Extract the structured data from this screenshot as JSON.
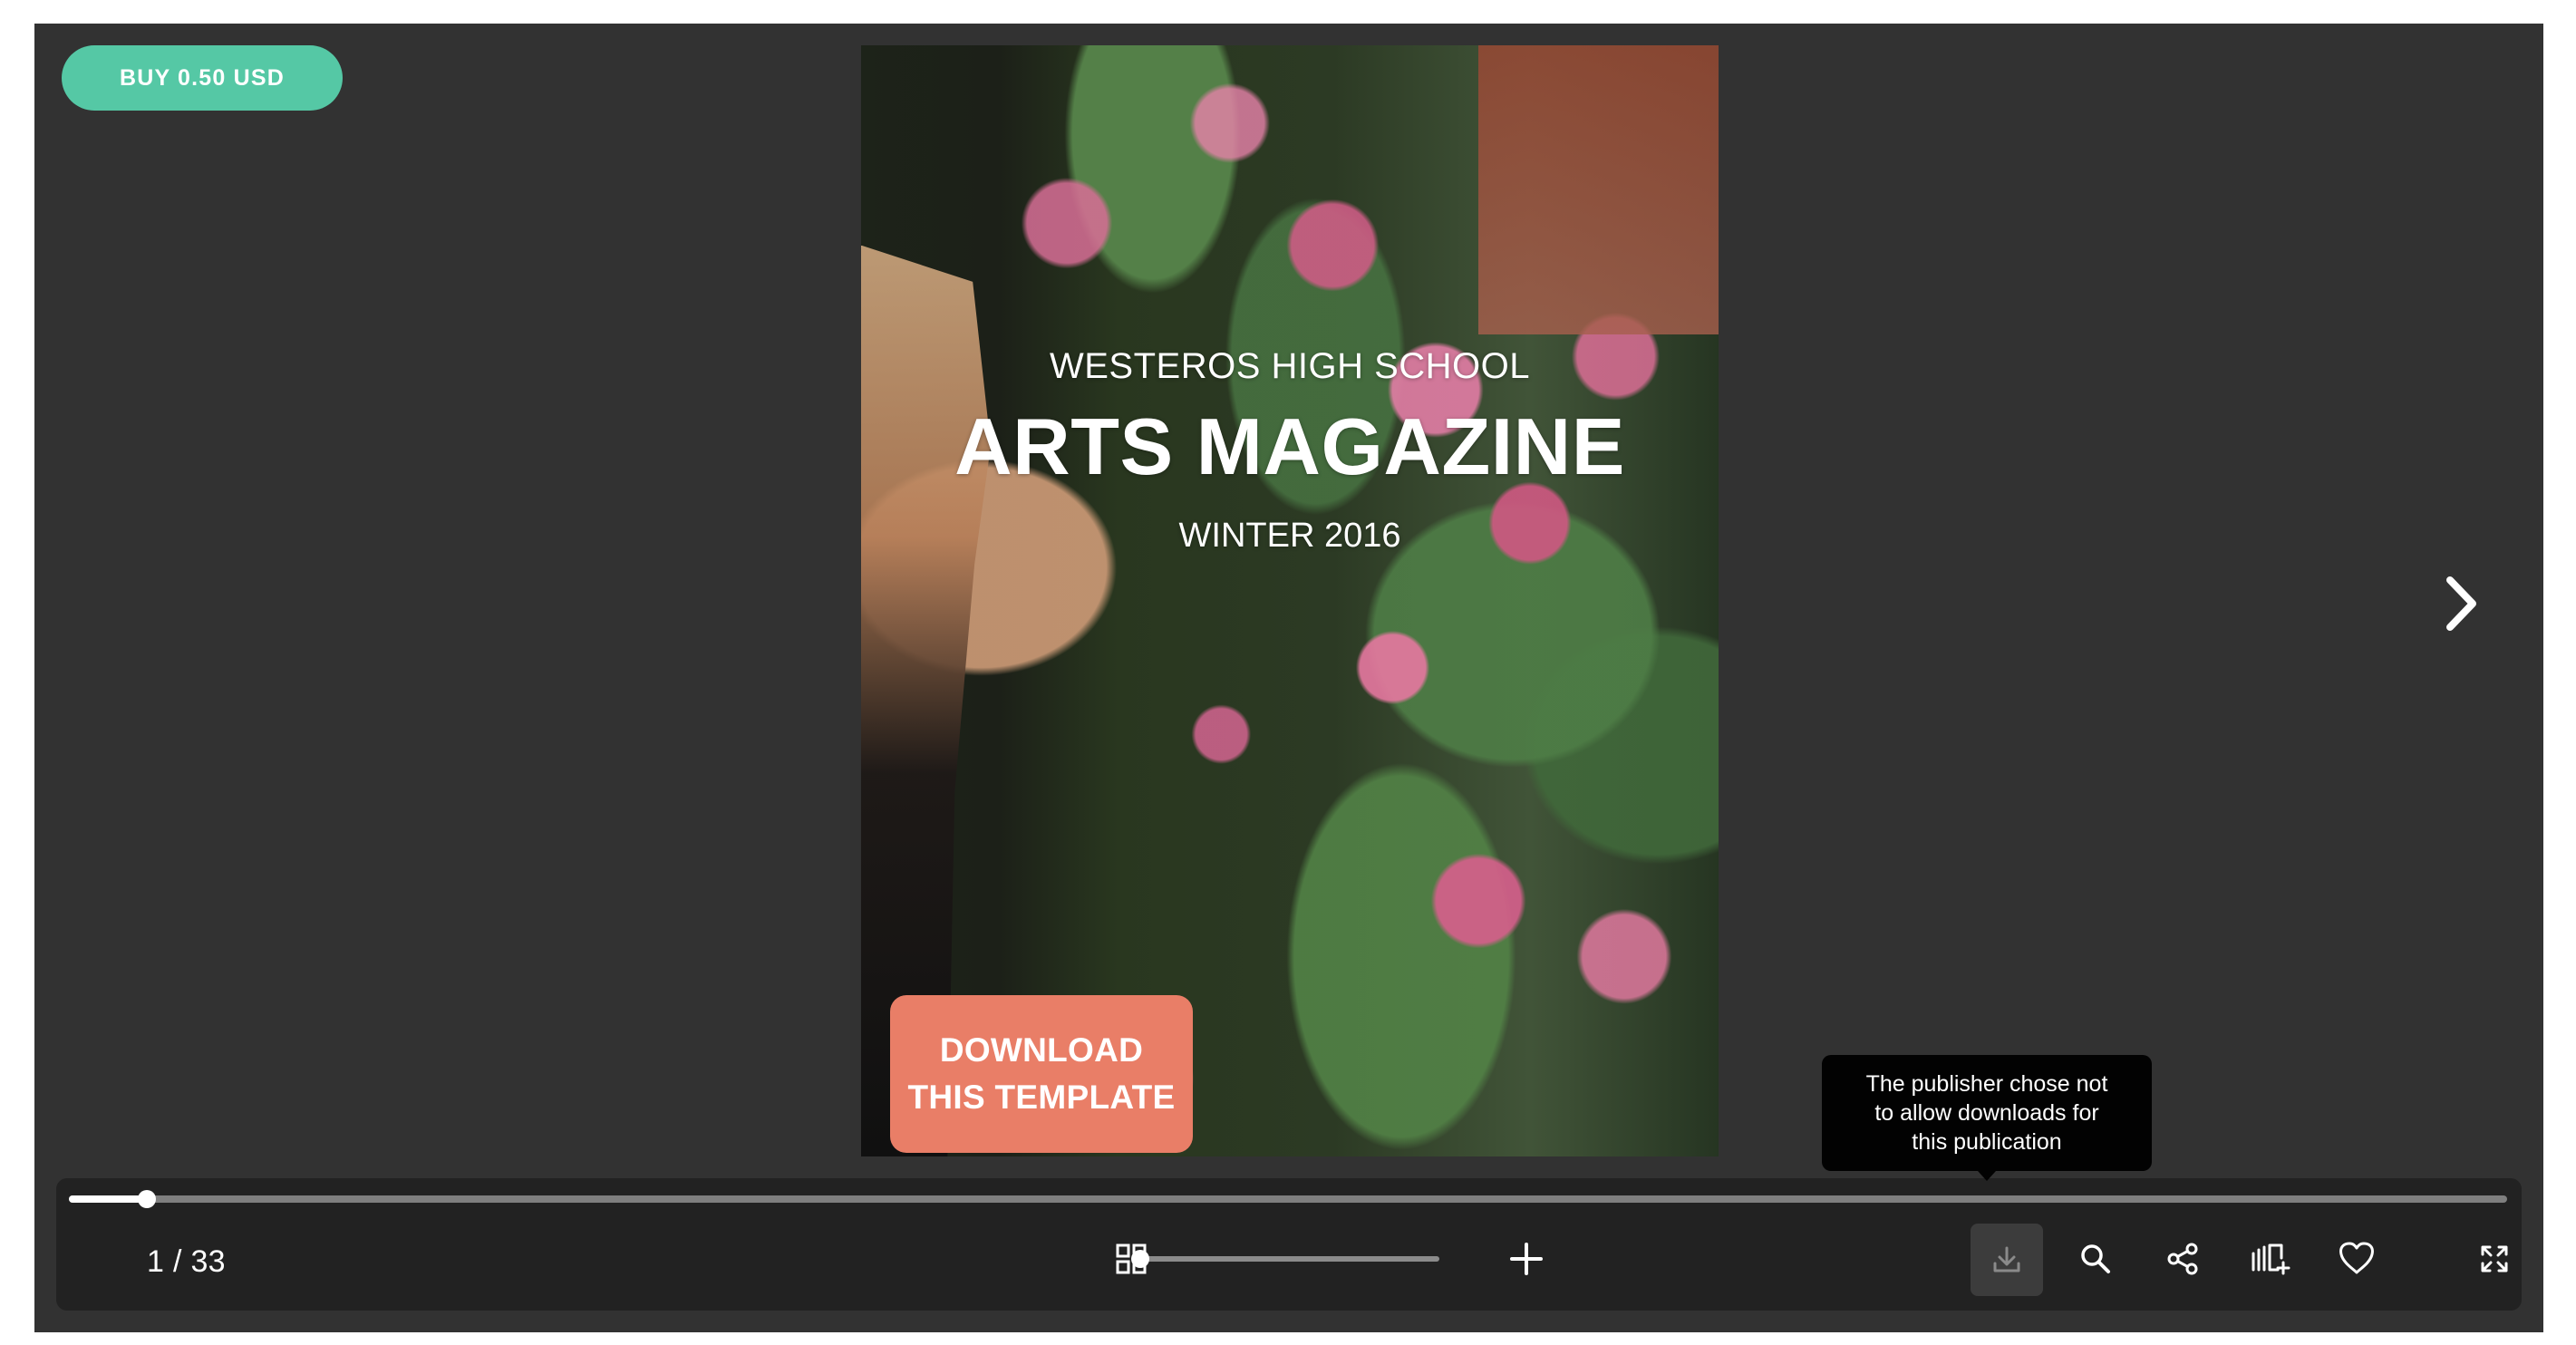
{
  "purchase": {
    "label": "BUY 0.50 USD"
  },
  "publication": {
    "overline": "WESTEROS HIGH SCHOOL",
    "title": "ARTS MAGAZINE",
    "season": "WINTER 2016",
    "promo_line_1": "DOWNLOAD",
    "promo_line_2": "THIS TEMPLATE"
  },
  "navigation": {
    "next_icon": "chevron-right-icon"
  },
  "tooltip": {
    "line_1": "The publisher chose not",
    "line_2": "to allow downloads for",
    "line_3": "this publication"
  },
  "toolbar": {
    "page_counter": "1 / 33",
    "progress_percent": 3.2,
    "zoom_percent": 0,
    "icons": {
      "thumbnails": "grid-icon",
      "zoom_in": "plus-icon",
      "download": "download-icon",
      "search": "search-icon",
      "share": "share-icon",
      "collection": "add-to-collection-icon",
      "like": "heart-icon",
      "fullscreen": "fullscreen-icon"
    }
  },
  "colors": {
    "viewer_background": "#323232",
    "toolbar_background": "#222222",
    "buy_button": "#55c8a5",
    "promo_badge": "#e97e67",
    "tooltip_background": "#020202"
  }
}
